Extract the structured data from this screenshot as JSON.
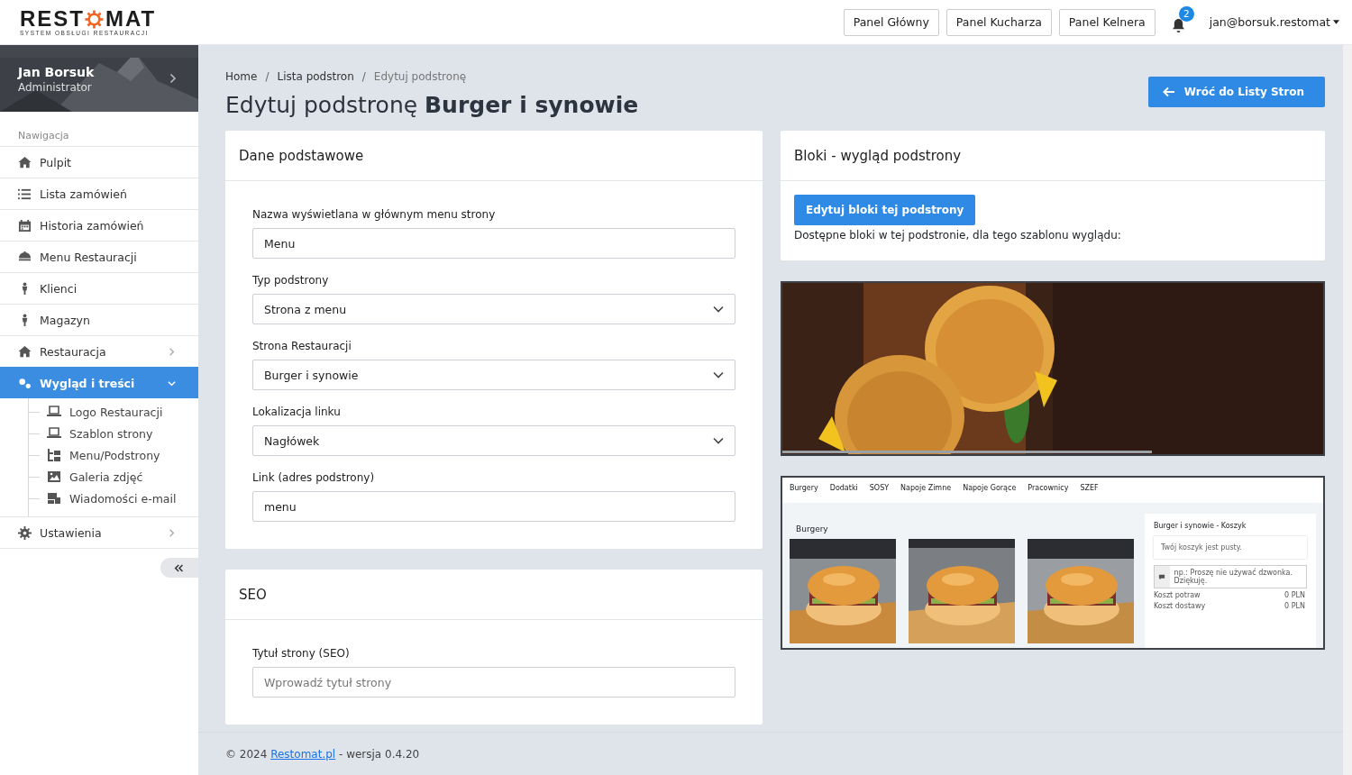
{
  "header": {
    "logo": {
      "word_left": "REST",
      "word_right": "MAT",
      "tagline": "SYSTEM OBSŁUGI RESTAURACJI"
    },
    "panels": [
      "Panel Główny",
      "Panel Kucharza",
      "Panel Kelnera"
    ],
    "notifications": "2",
    "user": "jan@borsuk.restomat"
  },
  "sidebar": {
    "user": {
      "name": "Jan Borsuk",
      "role": "Administrator"
    },
    "section": "Nawigacja",
    "items": [
      {
        "label": "Pulpit",
        "selected": false
      },
      {
        "label": "Lista zamówień",
        "selected": false
      },
      {
        "label": "Historia zamówień",
        "selected": false
      },
      {
        "label": "Menu Restauracji",
        "selected": false
      },
      {
        "label": "Klienci",
        "selected": false
      },
      {
        "label": "Magazyn",
        "selected": false
      },
      {
        "label": "Restauracja",
        "selected": false,
        "expanded": false
      },
      {
        "label": "Wygląd i treści",
        "selected": true,
        "expanded": true,
        "children": [
          {
            "label": "Logo Restauracji",
            "selected": false
          },
          {
            "label": "Szablon strony",
            "selected": false
          },
          {
            "label": "Menu/Podstrony",
            "selected": false
          },
          {
            "label": "Galeria zdjęć",
            "selected": false
          },
          {
            "label": "Wiadomości e-mail",
            "selected": false
          }
        ]
      },
      {
        "label": "Ustawienia",
        "selected": false,
        "expanded": false
      }
    ]
  },
  "breadcrumb_separator": "/",
  "breadcrumb": [
    {
      "label": "Home",
      "current": false
    },
    {
      "label": "Lista podstron",
      "current": false
    },
    {
      "label": "Edytuj podstronę",
      "current": true
    }
  ],
  "title": "Edytuj podstronę **Burger i synowie**",
  "back_button": "Wróć do Listy Stron",
  "basic_card": {
    "title": "Dane podstawowe",
    "fields": [
      {
        "kind": "text",
        "label": "Nazwa wyświetlana w głównym menu strony",
        "value": "Menu"
      },
      {
        "kind": "select",
        "label": "Typ podstrony",
        "value": "Strona z menu"
      },
      {
        "kind": "select",
        "label": "Strona Restauracji",
        "value": "Burger i synowie"
      },
      {
        "kind": "select",
        "label": "Lokalizacja linku",
        "value": "Nagłówek"
      },
      {
        "kind": "text",
        "label": "Link (adres podstrony)",
        "value": "menu"
      }
    ]
  },
  "seo_card": {
    "title": "SEO",
    "fields": [
      {
        "kind": "text",
        "label": "Tytuł strony (SEO)",
        "placeholder": "Wprowadź tytuł strony"
      }
    ]
  },
  "blocks_card": {
    "title": "Bloki - wygląd podstrony",
    "button": "Edytuj bloki tej podstrony",
    "note": "Dostępne bloki w tej podstronie, dla tego szablonu wyglądu:"
  },
  "preview": {
    "nav": [
      "Burgery",
      "Dodatki",
      "SOSY",
      "Napoje Zimne",
      "Napoje Gorące",
      "Pracownicy",
      "SZEF"
    ],
    "heading": "Burgery",
    "cart": {
      "title": "Burger i synowie - Koszyk",
      "empty": "Twój koszyk jest pusty.",
      "note_placeholder": "np.: Proszę nie używać dzwonka. Dziękuję.",
      "rows": [
        {
          "label": "Koszt potraw",
          "value": "0 PLN"
        },
        {
          "label": "Koszt dostawy",
          "value": "0 PLN"
        }
      ]
    }
  },
  "footer": {
    "prefix": "© 2024 ",
    "link": "Restomat.pl",
    "suffix": " - wersja 0.4.20"
  }
}
